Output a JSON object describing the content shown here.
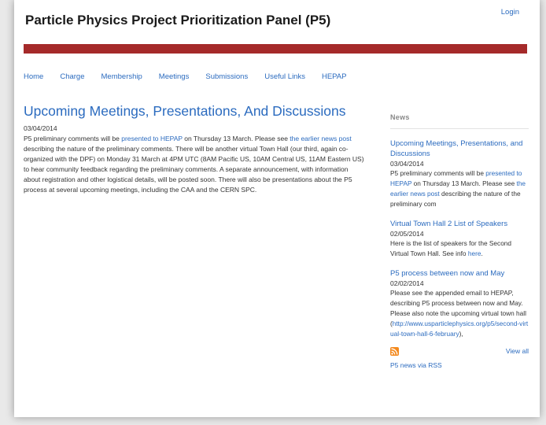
{
  "header": {
    "site_title": "Particle Physics Project Prioritization Panel (P5)",
    "login": "Login"
  },
  "nav": {
    "items": [
      "Home",
      "Charge",
      "Membership",
      "Meetings",
      "Submissions",
      "Useful Links",
      "HEPAP"
    ]
  },
  "main": {
    "title": "Upcoming Meetings, Presentations, And Discussions",
    "date": "03/04/2014",
    "p1": "P5 preliminary comments will be ",
    "link1": "presented to HEPAP",
    "p2": " on Thursday 13 March.  Please see ",
    "link2": "the earlier news post",
    "p3": " describing the nature of the preliminary comments.  There will be another virtual Town Hall (our third, again co-organized with the DPF) on Monday 31 March at 4PM UTC (8AM Pacific US, 10AM Central US, 11AM Eastern US) to hear community feedback regarding the preliminary comments.  A separate announcement, with information about registration and other logistical details, will be posted soon.  There will also be presentations about the P5 process at several upcoming meetings, including the CAA and the CERN SPC."
  },
  "sidebar": {
    "heading": "News",
    "items": [
      {
        "title": "Upcoming Meetings, Presentations, and Discussions",
        "date": "03/04/2014",
        "b1": "P5 preliminary comments will be ",
        "l1": "presented to HEPAP",
        "b2": " on Thursday 13 March.  Please see ",
        "l2": "the earlier news post",
        "b3": " describing the nature of the preliminary com"
      },
      {
        "title": "Virtual Town Hall 2 List of Speakers",
        "date": "02/05/2014",
        "b1": "Here is the list of speakers for the Second Virtual Town Hall.  See info ",
        "l1": "here",
        "b2": "."
      },
      {
        "title": "P5 process between now and May",
        "date": "02/02/2014",
        "b1": "Please see the appended email to HEPAP, describing P5 process between now and May.  Please also note the upcoming virtual town hall (",
        "l1": "http://www.usparticlephysics.org/p5/second-virtual-town-hall-6-february",
        "b2": "),"
      }
    ],
    "view_all": "View all",
    "rss": "P5 news via RSS"
  },
  "colors": {
    "banner": "#a52a2a",
    "link": "#2b6bbf",
    "rss": "#f4891d"
  }
}
